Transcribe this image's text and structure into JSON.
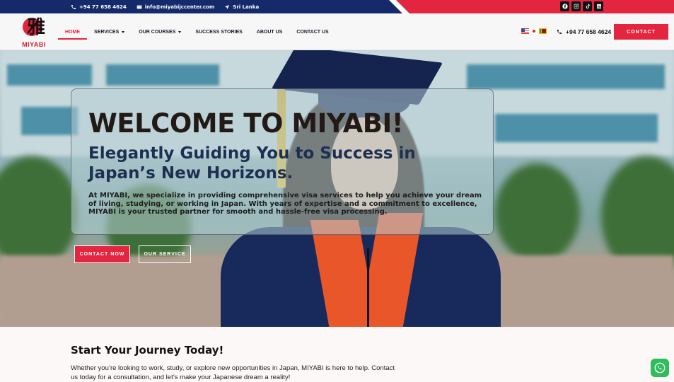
{
  "topbar": {
    "phone": "+94 77 658 4624",
    "email": "info@miyabijccenter.com",
    "location": "Sri Lanka",
    "socials": [
      "facebook-icon",
      "instagram-icon",
      "tiktok-icon",
      "linkedin-icon"
    ]
  },
  "header": {
    "logo_kanji": "雅",
    "logo_text": "MIYABI",
    "nav": [
      {
        "label": "HOME",
        "active": true
      },
      {
        "label": "SERVICES",
        "dropdown": true
      },
      {
        "label": "OUR COURSES",
        "dropdown": true
      },
      {
        "label": "SUCCESS STORIES"
      },
      {
        "label": "ABOUT US"
      },
      {
        "label": "CONTACT US"
      }
    ],
    "languages": [
      "English",
      "Japanese",
      "Sinhala"
    ],
    "phone": "+94 77 658 4624",
    "contact_label": "CONTACT"
  },
  "hero": {
    "title": "WELCOME TO MIYABI!",
    "subtitle": "Elegantly Guiding You to Success in Japan’s New Horizons.",
    "description": "At MIYABI, we specialize in providing comprehensive visa services to help you achieve your dream of living, studying, or working in Japan. With years of expertise and a commitment to excellence, MIYABI is your trusted partner for smooth and hassle-free visa processing.",
    "primary_button": "CONTACT NOW",
    "secondary_button": "OUR SERVICE"
  },
  "journey": {
    "title": "Start Your Journey Today!",
    "text": "Whether you’re looking to work, study, or explore new opportunities in Japan, MIYABI is here to help. Contact us today for a consultation, and let’s make your Japanese dream a reality!"
  },
  "colors": {
    "brand_red": "#e3253f",
    "navy": "#142a6b",
    "whatsapp_green": "#2dbe5a"
  }
}
